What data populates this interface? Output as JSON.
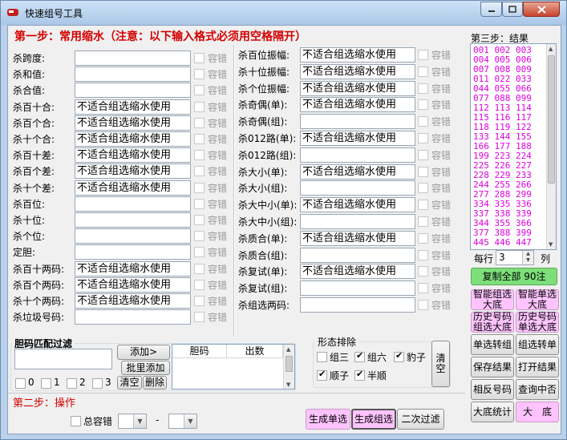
{
  "window": {
    "title": "快速组号工具"
  },
  "step1": {
    "title": "第一步：常用缩水（注意：以下输入格式必须用空格隔开）"
  },
  "step2": {
    "title": "第二步：操作"
  },
  "step3": {
    "title": "第三步：结果"
  },
  "filter_tip": "不适合组选缩水使用",
  "tolerance_label": "容错",
  "left_fields": [
    {
      "label": "杀跨度:",
      "value": ""
    },
    {
      "label": "杀和值:",
      "value": ""
    },
    {
      "label": "杀合值:",
      "value": ""
    },
    {
      "label": "杀百十合:",
      "value": "不适合组选缩水使用"
    },
    {
      "label": "杀百个合:",
      "value": "不适合组选缩水使用"
    },
    {
      "label": "杀十个合:",
      "value": "不适合组选缩水使用"
    },
    {
      "label": "杀百十差:",
      "value": "不适合组选缩水使用"
    },
    {
      "label": "杀百个差:",
      "value": "不适合组选缩水使用"
    },
    {
      "label": "杀十个差:",
      "value": "不适合组选缩水使用"
    },
    {
      "label": "杀百位:",
      "value": ""
    },
    {
      "label": "杀十位:",
      "value": ""
    },
    {
      "label": "杀个位:",
      "value": ""
    },
    {
      "label": "定胆:",
      "value": ""
    },
    {
      "label": "杀百十两码:",
      "value": "不适合组选缩水使用"
    },
    {
      "label": "杀百个两码:",
      "value": "不适合组选缩水使用"
    },
    {
      "label": "杀十个两码:",
      "value": "不适合组选缩水使用"
    },
    {
      "label": "杀垃圾号码:",
      "value": ""
    }
  ],
  "right_fields": [
    {
      "label": "杀百位振幅:",
      "value": "不适合组选缩水使用"
    },
    {
      "label": "杀十位振幅:",
      "value": "不适合组选缩水使用"
    },
    {
      "label": "杀个位振幅:",
      "value": "不适合组选缩水使用"
    },
    {
      "label": "杀奇偶(单):",
      "value": "不适合组选缩水使用"
    },
    {
      "label": "杀奇偶(组):",
      "value": ""
    },
    {
      "label": "杀012路(单):",
      "value": "不适合组选缩水使用"
    },
    {
      "label": "杀012路(组):",
      "value": ""
    },
    {
      "label": "杀大小(单):",
      "value": "不适合组选缩水使用"
    },
    {
      "label": "杀大小(组):",
      "value": ""
    },
    {
      "label": "杀大中小(单):",
      "value": "不适合组选缩水使用"
    },
    {
      "label": "杀大中小(组):",
      "value": ""
    },
    {
      "label": "杀质合(单):",
      "value": "不适合组选缩水使用"
    },
    {
      "label": "杀质合(组):",
      "value": ""
    },
    {
      "label": "杀复试(单):",
      "value": "不适合组选缩水使用"
    },
    {
      "label": "杀复试(组):",
      "value": ""
    },
    {
      "label": "杀组选两码:",
      "value": ""
    }
  ],
  "dan_filter": {
    "title": "胆码匹配过滤",
    "add_button": "添加>",
    "batch_add_button": "批里添加",
    "clear_button": "清空",
    "delete_button": "删除",
    "columns": [
      "胆码",
      "出数"
    ],
    "counts": [
      "0",
      "1",
      "2",
      "3"
    ]
  },
  "shape_exclude": {
    "title": "形态排除",
    "options": [
      {
        "label": "组三",
        "checked": false
      },
      {
        "label": "组六",
        "checked": true
      },
      {
        "label": "豹子",
        "checked": true
      },
      {
        "label": "顺子",
        "checked": true
      },
      {
        "label": "半顺",
        "checked": true
      }
    ],
    "clear_button": "清\n空"
  },
  "step2_controls": {
    "total_tolerance_label": "总容错",
    "dash": "-"
  },
  "actions": {
    "gen_single": "生成单选",
    "gen_group": "生成组选",
    "second_filter": "二次过滤"
  },
  "result": {
    "numbers": [
      "001 002 003",
      "004 005 006",
      "007 008 009",
      "011 022 033",
      "044 055 066",
      "077 088 099",
      "112 113 114",
      "115 116 117",
      "118 119 122",
      "133 144 155",
      "166 177 188",
      "199 223 224",
      "225 226 227",
      "228 229 233",
      "244 255 266",
      "277 288 299",
      "334 335 336",
      "337 338 339",
      "344 355 366",
      "377 388 399",
      "445 446 447"
    ],
    "per_row_label": "每行",
    "per_row_value": "3",
    "col_label": "列",
    "copy_button": "复制全部  90注"
  },
  "side_buttons": [
    [
      "智能组选\n大底",
      "智能单选\n大底"
    ],
    [
      "历史号码\n组选大底",
      "历史号码\n单选大底"
    ],
    [
      "单选转组",
      "组选转单"
    ],
    [
      "保存结果",
      "打开结果"
    ],
    [
      "相反号码",
      "查询中否"
    ],
    [
      "大底统计",
      "大　底"
    ]
  ]
}
